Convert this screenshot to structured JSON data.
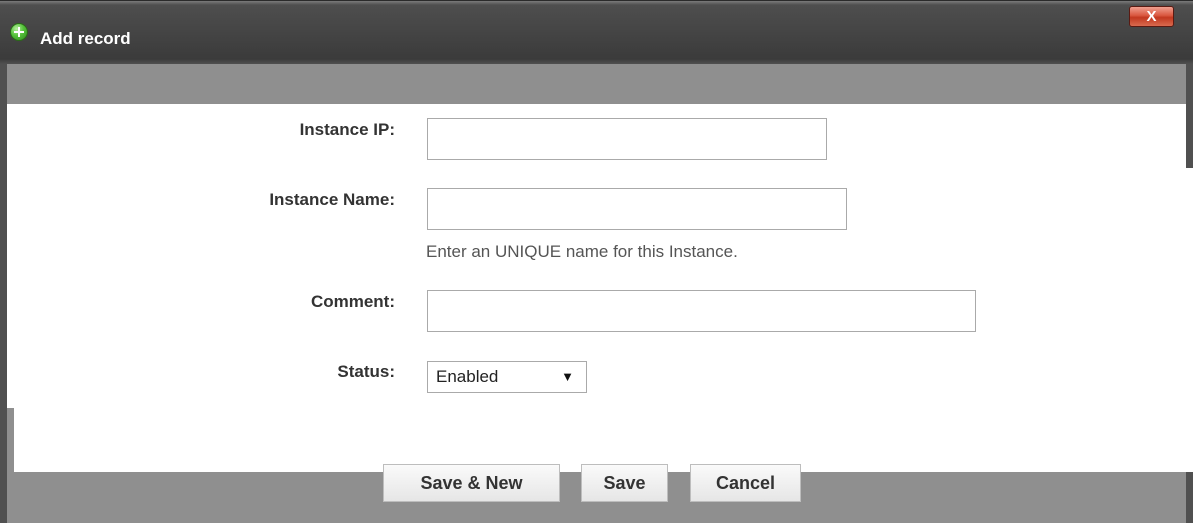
{
  "dialog": {
    "title": "Add record",
    "close_label": "X"
  },
  "form": {
    "instance_ip": {
      "label": "Instance IP:",
      "value": ""
    },
    "instance_name": {
      "label": "Instance Name:",
      "value": "",
      "hint": "Enter an UNIQUE name for this Instance."
    },
    "comment": {
      "label": "Comment:",
      "value": ""
    },
    "status": {
      "label": "Status:",
      "selected": "Enabled",
      "options": [
        "Enabled"
      ]
    }
  },
  "buttons": {
    "save_new": "Save & New",
    "save": "Save",
    "cancel": "Cancel"
  },
  "icons": {
    "title_icon": "add-circle-icon",
    "dropdown_arrow": "▼"
  },
  "colors": {
    "titlebar": "#454545",
    "frame": "#8f8f8f",
    "close_button": "#d9573f"
  }
}
